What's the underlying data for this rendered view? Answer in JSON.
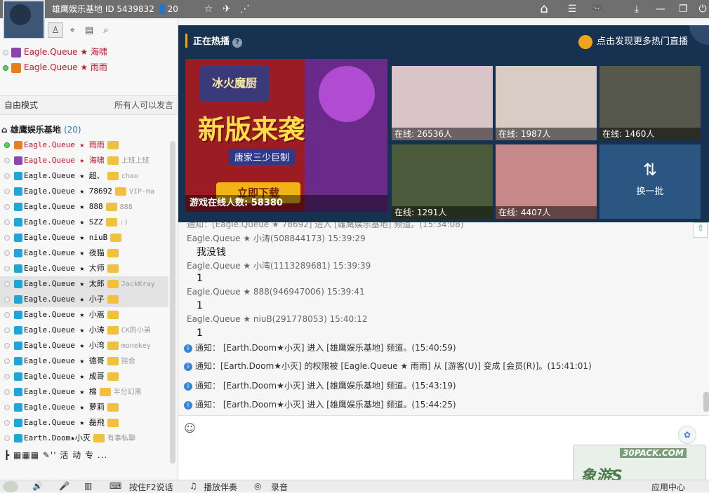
{
  "titlebar": {
    "title": "雄鹰娱乐基地  ID 5439832  👤20",
    "icons": [
      "star-icon",
      "share-icon",
      "home-icon",
      "list-icon",
      "gamepad-icon",
      "download-icon",
      "minimize-icon",
      "restore-icon",
      "power-icon"
    ]
  },
  "left_tabs": [
    "person-icon",
    "location-icon",
    "clipboard-icon",
    "search-icon"
  ],
  "admins": [
    {
      "name": "Eagle.Queue ★ 海啸",
      "online": false
    },
    {
      "name": "Eagle.Queue ★ 雨雨",
      "online": true
    }
  ],
  "mode": {
    "left": "自由模式",
    "right": "所有人可以发言"
  },
  "channel": {
    "name": "雄鹰娱乐基地",
    "count": "(20)"
  },
  "members": [
    {
      "name": "Eagle.Queue ★ 雨雨",
      "red": true,
      "extra": "",
      "online": true
    },
    {
      "name": "Eagle.Queue ★ 海啸",
      "red": true,
      "extra": "上班上班",
      "online": false
    },
    {
      "name": "Eagle.Queue ★ 超、",
      "red": false,
      "extra": "chao",
      "online": false
    },
    {
      "name": "Eagle.Queue ★ 78692",
      "red": false,
      "extra": "VIP-Ha",
      "online": false
    },
    {
      "name": "Eagle.Queue ★ 888",
      "red": false,
      "extra": "888",
      "online": false
    },
    {
      "name": "Eagle.Queue ★ SZZ",
      "red": false,
      "extra": ":)",
      "online": false
    },
    {
      "name": "Eagle.Queue ★ niuB",
      "red": false,
      "extra": "",
      "online": false
    },
    {
      "name": "Eagle.Queue ★ 夜猫",
      "red": false,
      "extra": "",
      "online": false
    },
    {
      "name": "Eagle.Queue ★ 大师",
      "red": false,
      "extra": "",
      "online": false
    },
    {
      "name": "Eagle.Queue ★ 太郎",
      "red": false,
      "extra": "JackKray",
      "online": false,
      "hl": true
    },
    {
      "name": "Eagle.Queue ★ 小子",
      "red": false,
      "extra": "",
      "online": false,
      "hl": true
    },
    {
      "name": "Eagle.Queue ★ 小嵩",
      "red": false,
      "extra": "",
      "online": false
    },
    {
      "name": "Eagle.Queue ★ 小涛",
      "red": false,
      "extra": "CK的小弟",
      "online": false
    },
    {
      "name": "Eagle.Queue ★ 小湾",
      "red": false,
      "extra": "monekey",
      "online": false
    },
    {
      "name": "Eagle.Queue ★ 德哥",
      "red": false,
      "extra": "挂会",
      "online": false
    },
    {
      "name": "Eagle.Queue ★ 成哥",
      "red": false,
      "extra": "",
      "online": false
    },
    {
      "name": "Eagle.Queue ★ 棉",
      "red": false,
      "extra": "半分幻黑",
      "online": false
    },
    {
      "name": "Eagle.Queue ★ 萝莉",
      "red": false,
      "extra": "",
      "online": false
    },
    {
      "name": "Eagle.Queue ★ 磊飛",
      "red": false,
      "extra": "",
      "online": false
    },
    {
      "name": "Earth.Doom★小灭",
      "red": false,
      "extra": "有事私聊",
      "online": false
    }
  ],
  "left_bottom_text": "┣   ▦▦▦  ✎'' 活   动   专 ...",
  "hot": {
    "title": "正在热播",
    "more": "点击发现更多热门直播",
    "banner": {
      "logo": "冰火魔厨",
      "headline": "新版来袭",
      "subtitle": "唐家三少巨制",
      "button": "立即下载",
      "online": "游戏在线人数: 58380"
    },
    "thumbs": [
      {
        "caption": "在线: 26536人",
        "color": "#d9c4c8"
      },
      {
        "caption": "在线: 1987人",
        "color": "#d8ccc4"
      },
      {
        "caption": "在线: 1460人",
        "color": "#55584a"
      },
      {
        "caption": "在线: 1291人",
        "color": "#4b5a3a"
      },
      {
        "caption": "在线: 4407人",
        "color": "#c7888a"
      }
    ],
    "refresh": "换一批"
  },
  "chat": {
    "top_fragment": "通知：[Eagle.Queue ★ 78692] 进入 [雄鹰娱乐基地] 频道。(15:34:08)",
    "messages": [
      {
        "meta": "Eagle.Queue ★ 小涛(508844173) 15:39:29",
        "text": "我没钱"
      },
      {
        "meta": "Eagle.Queue ★ 小湾(1113289681) 15:39:39",
        "text": "1"
      },
      {
        "meta": "Eagle.Queue ★ 888(946947006) 15:39:41",
        "text": "1"
      },
      {
        "meta": "Eagle.Queue ★ niuB(291778053) 15:40:12",
        "text": "1"
      }
    ],
    "notices": [
      "通知： [Earth.Doom★小灭] 进入 [雄鹰娱乐基地] 频道。(15:40:59)",
      "通知：[Earth.Doom★小灭] 的权限被 [Eagle.Queue ★ 雨雨] 从 [游客(U)] 变成 [会员(R)]。(15:41:01)",
      "通知： [Earth.Doom★小灭] 进入 [雄鹰娱乐基地] 频道。(15:43:19)",
      "通知： [Earth.Doom★小灭] 进入 [雄鹰娱乐基地] 频道。(15:44:25)"
    ]
  },
  "footer": {
    "items": [
      "按住F2说话",
      "播放伴奏",
      "录音",
      "应用中心"
    ]
  },
  "watermark": {
    "line1": "30PACK.COM",
    "line2": "象游S"
  }
}
